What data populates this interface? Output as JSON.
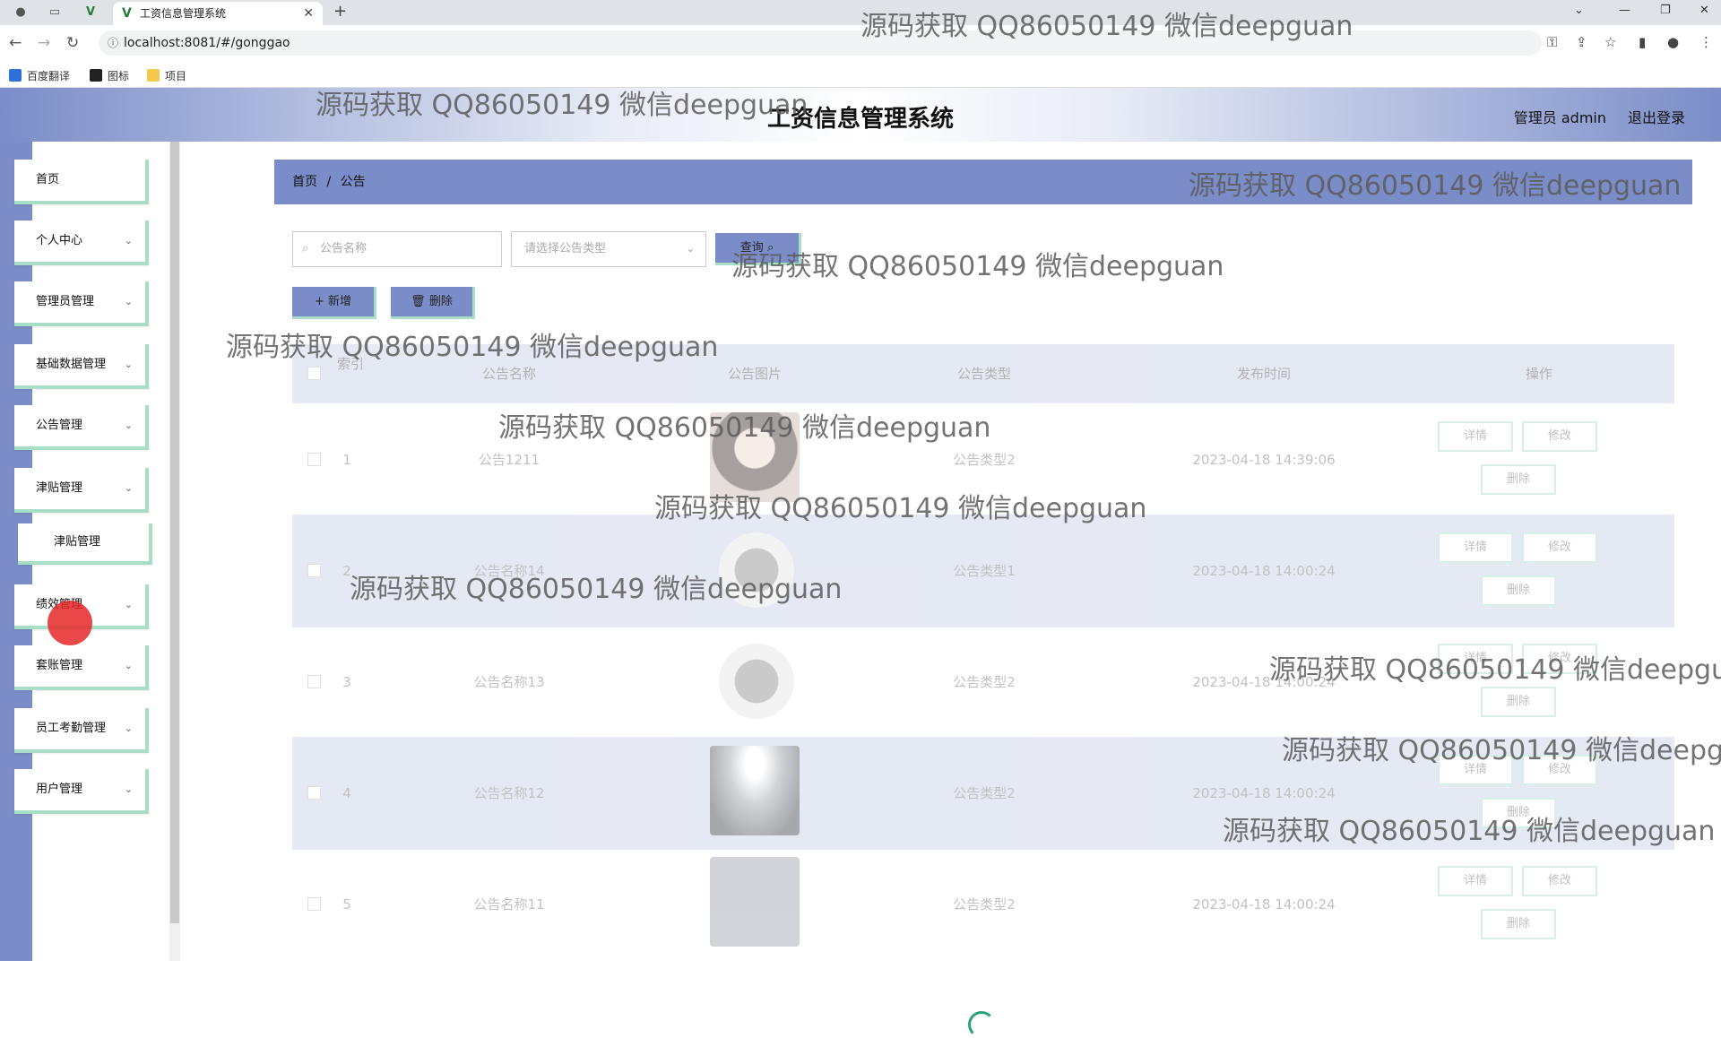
{
  "browser": {
    "tab_title": "工资信息管理系统",
    "new_tab": "+",
    "url": "localhost:8081/#/gonggao",
    "bookmarks": [
      {
        "label": "百度翻译",
        "color": "#2f6fd8"
      },
      {
        "label": "图标",
        "color": "#222222"
      },
      {
        "label": "项目",
        "color": "#f2c94c"
      }
    ]
  },
  "header": {
    "title": "工资信息管理系统",
    "user": "管理员 admin",
    "logout": "退出登录"
  },
  "sidebar": {
    "items": [
      {
        "label": "首页",
        "has_chevron": false
      },
      {
        "label": "个人中心",
        "has_chevron": true
      },
      {
        "label": "管理员管理",
        "has_chevron": true
      },
      {
        "label": "基础数据管理",
        "has_chevron": true
      },
      {
        "label": "公告管理",
        "has_chevron": true
      },
      {
        "label": "津贴管理",
        "has_chevron": true
      },
      {
        "label": "津贴管理",
        "has_chevron": false
      },
      {
        "label": "绩效管理",
        "has_chevron": true
      },
      {
        "label": "套账管理",
        "has_chevron": true
      },
      {
        "label": "员工考勤管理",
        "has_chevron": true
      },
      {
        "label": "用户管理",
        "has_chevron": true
      }
    ]
  },
  "breadcrumb": {
    "home": "首页",
    "separator": "/",
    "current": "公告"
  },
  "filters": {
    "name_placeholder": "公告名称",
    "type_placeholder": "请选择公告类型",
    "query_label": "查询"
  },
  "actions": {
    "add_label": "+ 新增",
    "delete_label": "删除"
  },
  "table": {
    "columns": [
      "索引",
      "公告名称",
      "公告图片",
      "公告类型",
      "发布时间",
      "操作"
    ],
    "rows": [
      {
        "index": "1",
        "name": "公告1211",
        "image": "portrait",
        "type": "公告类型2",
        "time": "2023-04-18 14:39:06"
      },
      {
        "index": "2",
        "name": "公告名称14",
        "image": "news-globe",
        "type": "公告类型1",
        "time": "2023-04-18 14:00:24"
      },
      {
        "index": "3",
        "name": "公告名称13",
        "image": "news-globe",
        "type": "公告类型2",
        "time": "2023-04-18 14:00:24"
      },
      {
        "index": "4",
        "name": "公告名称12",
        "image": "stage-light",
        "type": "公告类型2",
        "time": "2023-04-18 14:00:24"
      },
      {
        "index": "5",
        "name": "公告名称11",
        "image": "cctv-news",
        "type": "公告类型2",
        "time": "2023-04-18 14:00:24"
      }
    ],
    "op_detail": "详情",
    "op_edit": "修改",
    "op_delete": "删除"
  },
  "watermark": "源码获取 QQ86050149 微信deepguan"
}
